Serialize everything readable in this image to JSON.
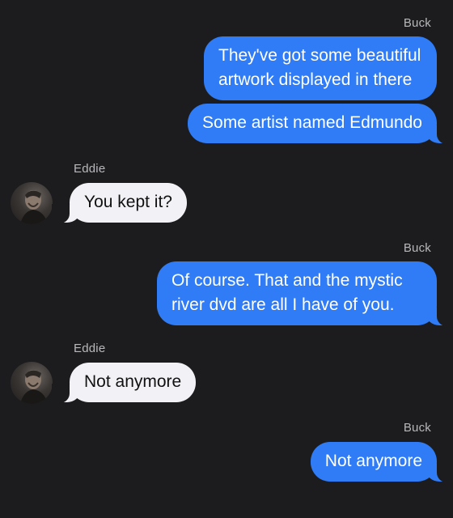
{
  "messages": [
    {
      "sender": "Buck",
      "side": "outgoing",
      "bubbles": [
        "They've got some beautiful artwork displayed in there",
        "Some artist named Edmundo"
      ]
    },
    {
      "sender": "Eddie",
      "side": "incoming",
      "bubbles": [
        "You kept it?"
      ]
    },
    {
      "sender": "Buck",
      "side": "outgoing",
      "bubbles": [
        "Of course. That and the mystic river dvd are all I have of you."
      ]
    },
    {
      "sender": "Eddie",
      "side": "incoming",
      "bubbles": [
        "Not anymore"
      ]
    },
    {
      "sender": "Buck",
      "side": "outgoing",
      "bubbles": [
        "Not anymore"
      ]
    }
  ],
  "colors": {
    "background": "#1c1c1e",
    "outgoing_bubble": "#2f7cf6",
    "incoming_bubble": "#f2f2f6",
    "sender_label": "#b8b8bc"
  },
  "icons": {
    "avatar": "eddie-avatar-icon"
  }
}
